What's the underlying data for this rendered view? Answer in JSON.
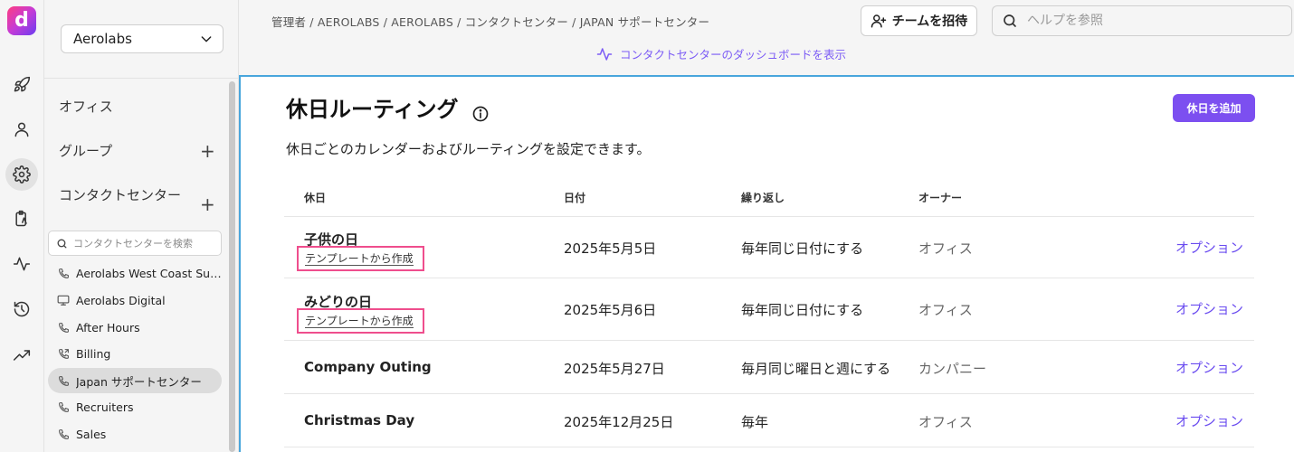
{
  "brand": {
    "logo_letter": "d",
    "accent": "#7c4ff0",
    "focus_border": "#49a6dc",
    "highlight": "#ef4e8d"
  },
  "rail": {
    "icons": [
      "rocket-icon",
      "person-icon",
      "gear-icon",
      "clipboard-icon",
      "activity-icon",
      "history-icon",
      "trending-up-icon"
    ],
    "active": "gear-icon"
  },
  "sidebar": {
    "org": "Aerolabs",
    "sections": [
      {
        "label": "オフィス",
        "has_add": false
      },
      {
        "label": "グループ",
        "has_add": true
      },
      {
        "label": "コンタクトセンター",
        "has_add": true
      }
    ],
    "search_placeholder": "コンタクトセンターを検索",
    "items": [
      {
        "label": "Aerolabs West Coast Supp...",
        "icon": "phone-icon",
        "active": false
      },
      {
        "label": "Aerolabs Digital",
        "icon": "monitor-icon",
        "active": false
      },
      {
        "label": "After Hours",
        "icon": "phone-icon",
        "active": false
      },
      {
        "label": "Billing",
        "icon": "phone-transfer-icon",
        "active": false
      },
      {
        "label": "Japan サポートセンター",
        "icon": "phone-icon",
        "active": true
      },
      {
        "label": "Recruiters",
        "icon": "phone-icon",
        "active": false
      },
      {
        "label": "Sales",
        "icon": "phone-icon",
        "active": false
      }
    ]
  },
  "header": {
    "breadcrumb": "管理者 / AEROLABS / AEROLABS / コンタクトセンター / JAPAN サポートセンター",
    "invite_label": "チームを招待",
    "help_placeholder": "ヘルプを参照",
    "dashboard_link": "コンタクトセンターのダッシュボードを表示"
  },
  "main": {
    "title": "休日ルーティング",
    "add_label": "休日を追加",
    "subtitle": "休日ごとのカレンダーおよびルーティングを設定できます。",
    "columns": [
      "休日",
      "日付",
      "繰り返し",
      "オーナー"
    ],
    "rows": [
      {
        "name": "子供の日",
        "template": "テンプレートから作成",
        "date": "2025年5月5日",
        "repeat": "毎年同じ日付にする",
        "owner": "オフィス",
        "option": "オプション"
      },
      {
        "name": "みどりの日",
        "template": "テンプレートから作成",
        "date": "2025年5月6日",
        "repeat": "毎年同じ日付にする",
        "owner": "オフィス",
        "option": "オプション"
      },
      {
        "name": "Company Outing",
        "template": "",
        "date": "2025年5月27日",
        "repeat": "毎月同じ曜日と週にする",
        "owner": "カンパニー",
        "option": "オプション"
      },
      {
        "name": "Christmas Day",
        "template": "",
        "date": "2025年12月25日",
        "repeat": "毎年",
        "owner": "オフィス",
        "option": "オプション"
      }
    ]
  }
}
